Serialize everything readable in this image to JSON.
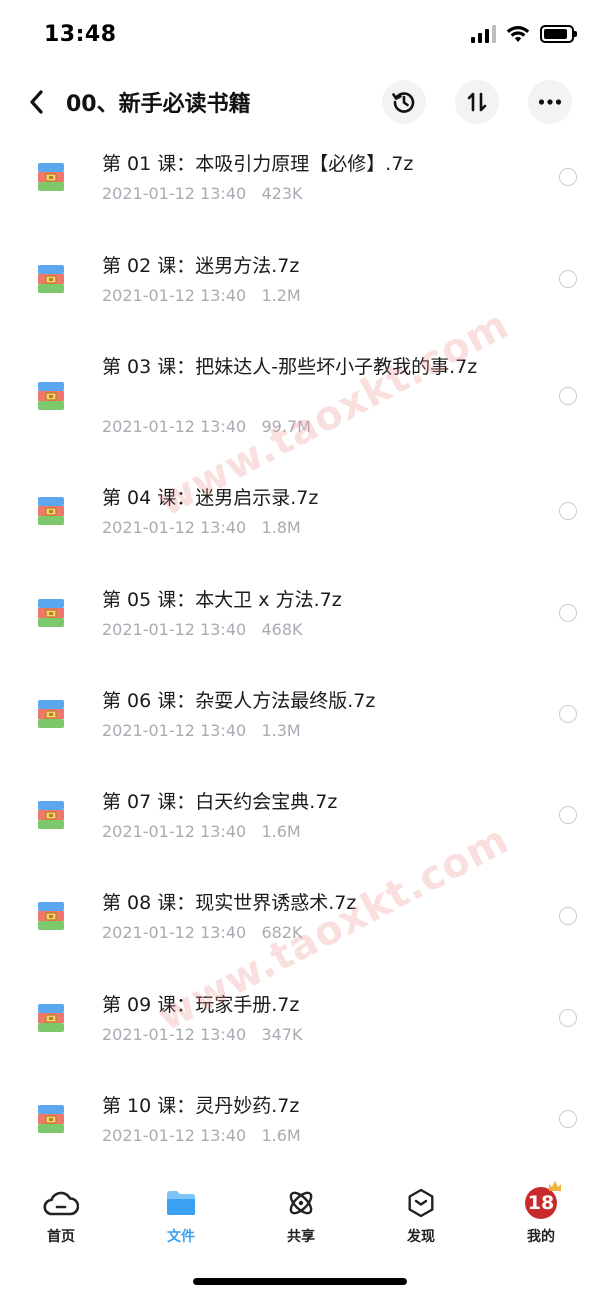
{
  "status_bar": {
    "time": "13:48",
    "battery_level": 0.9
  },
  "header": {
    "title": "00、新手必读书籍",
    "icons": {
      "back": "chevron-left-icon",
      "history": "history-icon",
      "sort": "sort-icon",
      "more": "more-icon"
    }
  },
  "files": [
    {
      "name": "第 01 课：本吸引力原理【必修】.7z",
      "date": "2021-01-12 13:40",
      "size": "423K"
    },
    {
      "name": "第 02 课：迷男方法.7z",
      "date": "2021-01-12 13:40",
      "size": "1.2M"
    },
    {
      "name": "第 03 课：把妹达人-那些坏小子教我的事.7z",
      "date": "2021-01-12 13:40",
      "size": "99.7M"
    },
    {
      "name": "第 04 课：迷男启示录.7z",
      "date": "2021-01-12 13:40",
      "size": "1.8M"
    },
    {
      "name": "第 05 课：本大卫 x 方法.7z",
      "date": "2021-01-12 13:40",
      "size": "468K"
    },
    {
      "name": "第 06 课：杂耍人方法最终版.7z",
      "date": "2021-01-12 13:40",
      "size": "1.3M"
    },
    {
      "name": "第 07 课：白天约会宝典.7z",
      "date": "2021-01-12 13:40",
      "size": "1.6M"
    },
    {
      "name": "第 08 课：现实世界诱惑术.7z",
      "date": "2021-01-12 13:40",
      "size": "682K"
    },
    {
      "name": "第 09 课：玩家手册.7z",
      "date": "2021-01-12 13:40",
      "size": "347K"
    },
    {
      "name": "第 10 课：灵丹妙药.7z",
      "date": "2021-01-12 13:40",
      "size": "1.6M"
    }
  ],
  "watermark": "www.taoxkt.com",
  "tabs": [
    {
      "label": "首页",
      "icon": "cloud-icon"
    },
    {
      "label": "文件",
      "icon": "folder-icon",
      "active": true
    },
    {
      "label": "共享",
      "icon": "atom-icon"
    },
    {
      "label": "发现",
      "icon": "compass-icon"
    },
    {
      "label": "我的",
      "icon": "avatar-icon",
      "badge": "18"
    }
  ],
  "colors": {
    "accent": "#3aa0f2",
    "meta_text": "#a7acb3",
    "watermark": "#ec8c8c"
  }
}
